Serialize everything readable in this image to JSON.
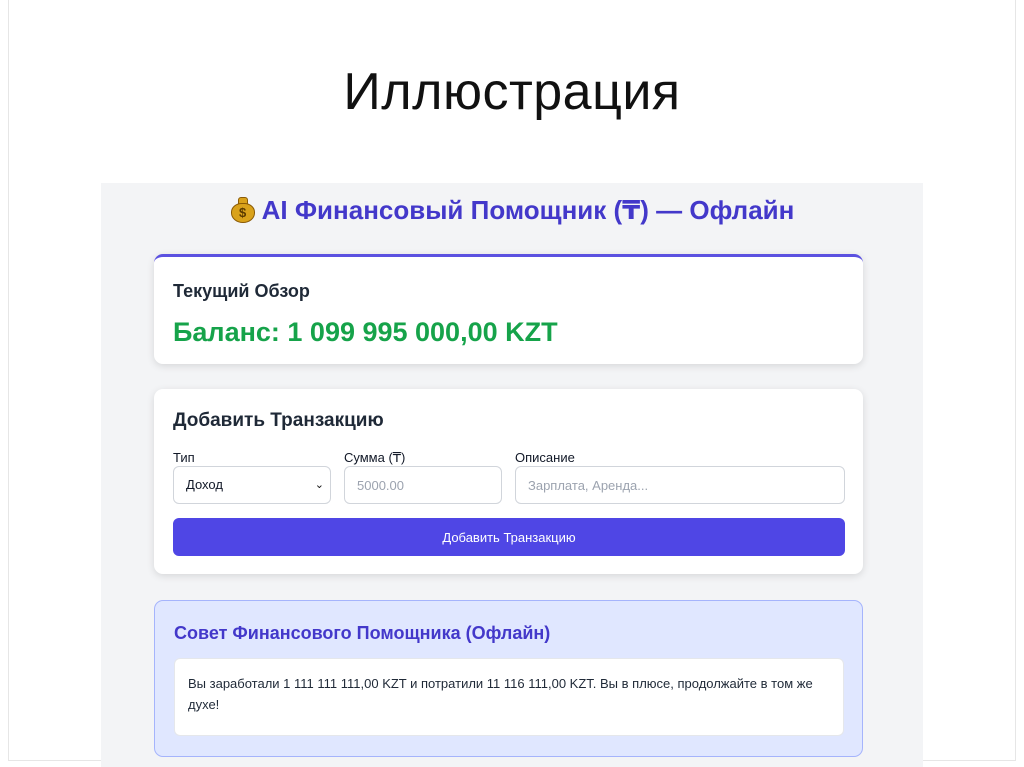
{
  "slide": {
    "title": "Иллюстрация"
  },
  "app": {
    "header": {
      "icon": "moneybag-icon",
      "title": "AI Финансовый Помощник (₸) — Офлайн"
    },
    "overview": {
      "title": "Текущий Обзор",
      "balance": "Баланс: 1 099 995 000,00 KZT"
    },
    "add_transaction": {
      "title": "Добавить Транзакцию",
      "type_label": "Тип",
      "type_value": "Доход",
      "amount_label": "Сумма (₸)",
      "amount_placeholder": "5000.00",
      "description_label": "Описание",
      "description_placeholder": "Зарплата, Аренда...",
      "button_label": "Добавить Транзакцию"
    },
    "advice": {
      "title": "Совет Финансового Помощника (Офлайн)",
      "text": "Вы заработали 1 111 111 111,00 KZT и потратили 11 116 111,00 KZT. Вы в плюсе, продолжайте в том же духе!"
    }
  },
  "colors": {
    "accent": "#4f46e5",
    "header_text": "#4338ca",
    "balance_positive": "#16a34a",
    "advice_background": "#e0e7ff"
  }
}
